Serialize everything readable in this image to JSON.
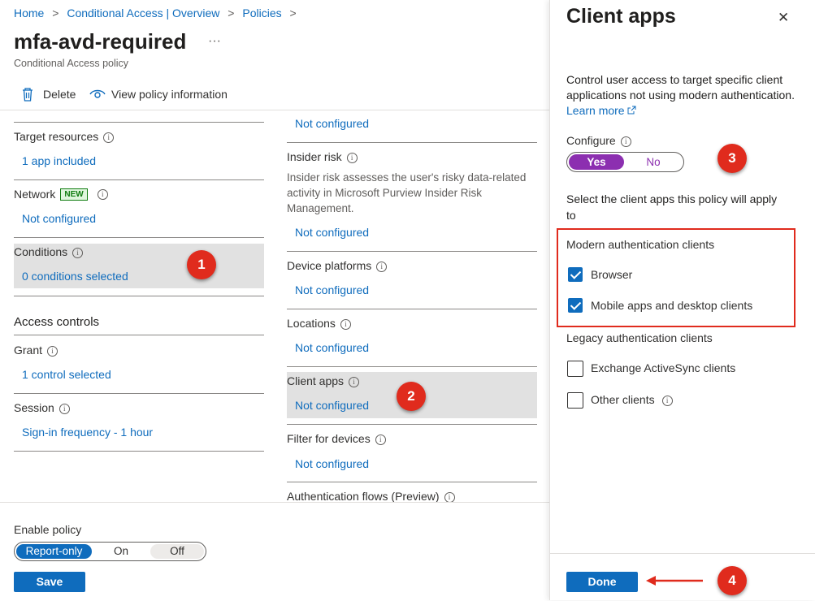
{
  "breadcrumb": {
    "home": "Home",
    "sep": ">",
    "overview": "Conditional Access | Overview",
    "policies": "Policies"
  },
  "page": {
    "title": "mfa-avd-required",
    "more": "···",
    "subtitle": "Conditional Access policy"
  },
  "toolbar": {
    "delete_label": "Delete",
    "view_label": "View policy information"
  },
  "left": {
    "target_resources": {
      "label": "Target resources",
      "value": "1 app included"
    },
    "network": {
      "label": "Network",
      "badge": "NEW",
      "value": "Not configured"
    },
    "conditions": {
      "label": "Conditions",
      "value": "0 conditions selected"
    },
    "access_controls": "Access controls",
    "grant": {
      "label": "Grant",
      "value": "1 control selected"
    },
    "session": {
      "label": "Session",
      "value": "Sign-in frequency - 1 hour"
    }
  },
  "middle": {
    "top_value": "Not configured",
    "insider_risk": {
      "label": "Insider risk",
      "desc": "Insider risk assesses the user's risky data-related activity in Microsoft Purview Insider Risk Management.",
      "value": "Not configured"
    },
    "device_platforms": {
      "label": "Device platforms",
      "value": "Not configured"
    },
    "locations": {
      "label": "Locations",
      "value": "Not configured"
    },
    "client_apps": {
      "label": "Client apps",
      "value": "Not configured"
    },
    "filter_devices": {
      "label": "Filter for devices",
      "value": "Not configured"
    },
    "auth_flows": {
      "label": "Authentication flows (Preview)"
    }
  },
  "enable_policy": {
    "label": "Enable policy",
    "options": [
      "Report-only",
      "On",
      "Off"
    ],
    "selected": "Report-only",
    "save_label": "Save"
  },
  "panel": {
    "title": "Client apps",
    "close": "✕",
    "description": "Control user access to target specific client applications not using modern authentication.",
    "learn_more": "Learn more",
    "configure_label": "Configure",
    "toggle_yes": "Yes",
    "toggle_no": "No",
    "select_text": "Select the client apps this policy will apply to",
    "modern_heading": "Modern authentication clients",
    "browser": "Browser",
    "mobile": "Mobile apps and desktop clients",
    "legacy_heading": "Legacy authentication clients",
    "exchange": "Exchange ActiveSync clients",
    "other": "Other clients",
    "done_label": "Done"
  },
  "annotations": [
    "1",
    "2",
    "3",
    "4"
  ],
  "colors": {
    "accent": "#0f6cbd",
    "toggle_purple": "#8c2fb0",
    "annotation_red": "#e02b1d",
    "highlight_gray": "#e1e1e1"
  }
}
